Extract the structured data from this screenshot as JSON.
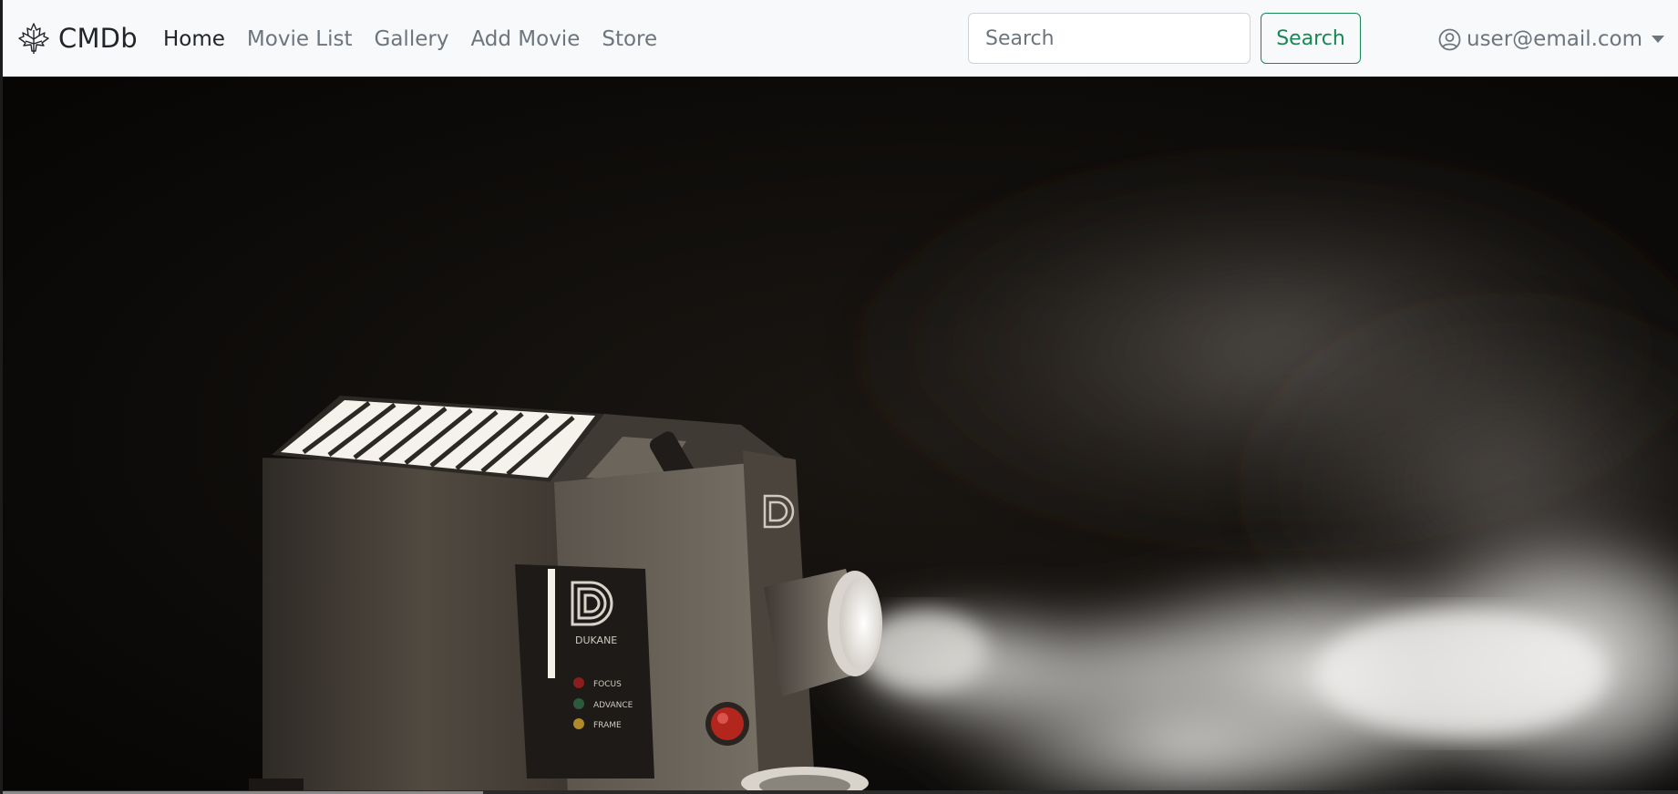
{
  "navbar": {
    "brand": {
      "icon": "maple-leaf-icon",
      "name": "CMDb"
    },
    "links": [
      {
        "label": "Home",
        "active": true
      },
      {
        "label": "Movie List",
        "active": false
      },
      {
        "label": "Gallery",
        "active": false
      },
      {
        "label": "Add Movie",
        "active": false
      },
      {
        "label": "Store",
        "active": false
      }
    ],
    "search": {
      "placeholder": "Search",
      "value": "",
      "button_label": "Search"
    },
    "user": {
      "icon": "user-circle-icon",
      "email": "user@email.com",
      "dropdown_icon": "caret-down-icon"
    }
  },
  "hero": {
    "image": "film-projector-with-smoke-beam",
    "projector_brand": "DUKANE",
    "controls": [
      "FOCUS",
      "ADVANCE",
      "FRAME"
    ]
  },
  "colors": {
    "navbar_bg": "#f8f9fa",
    "link_muted": "#6c757d",
    "link_active": "#212529",
    "search_button": "#198754",
    "hero_bg": "#0b0908"
  }
}
